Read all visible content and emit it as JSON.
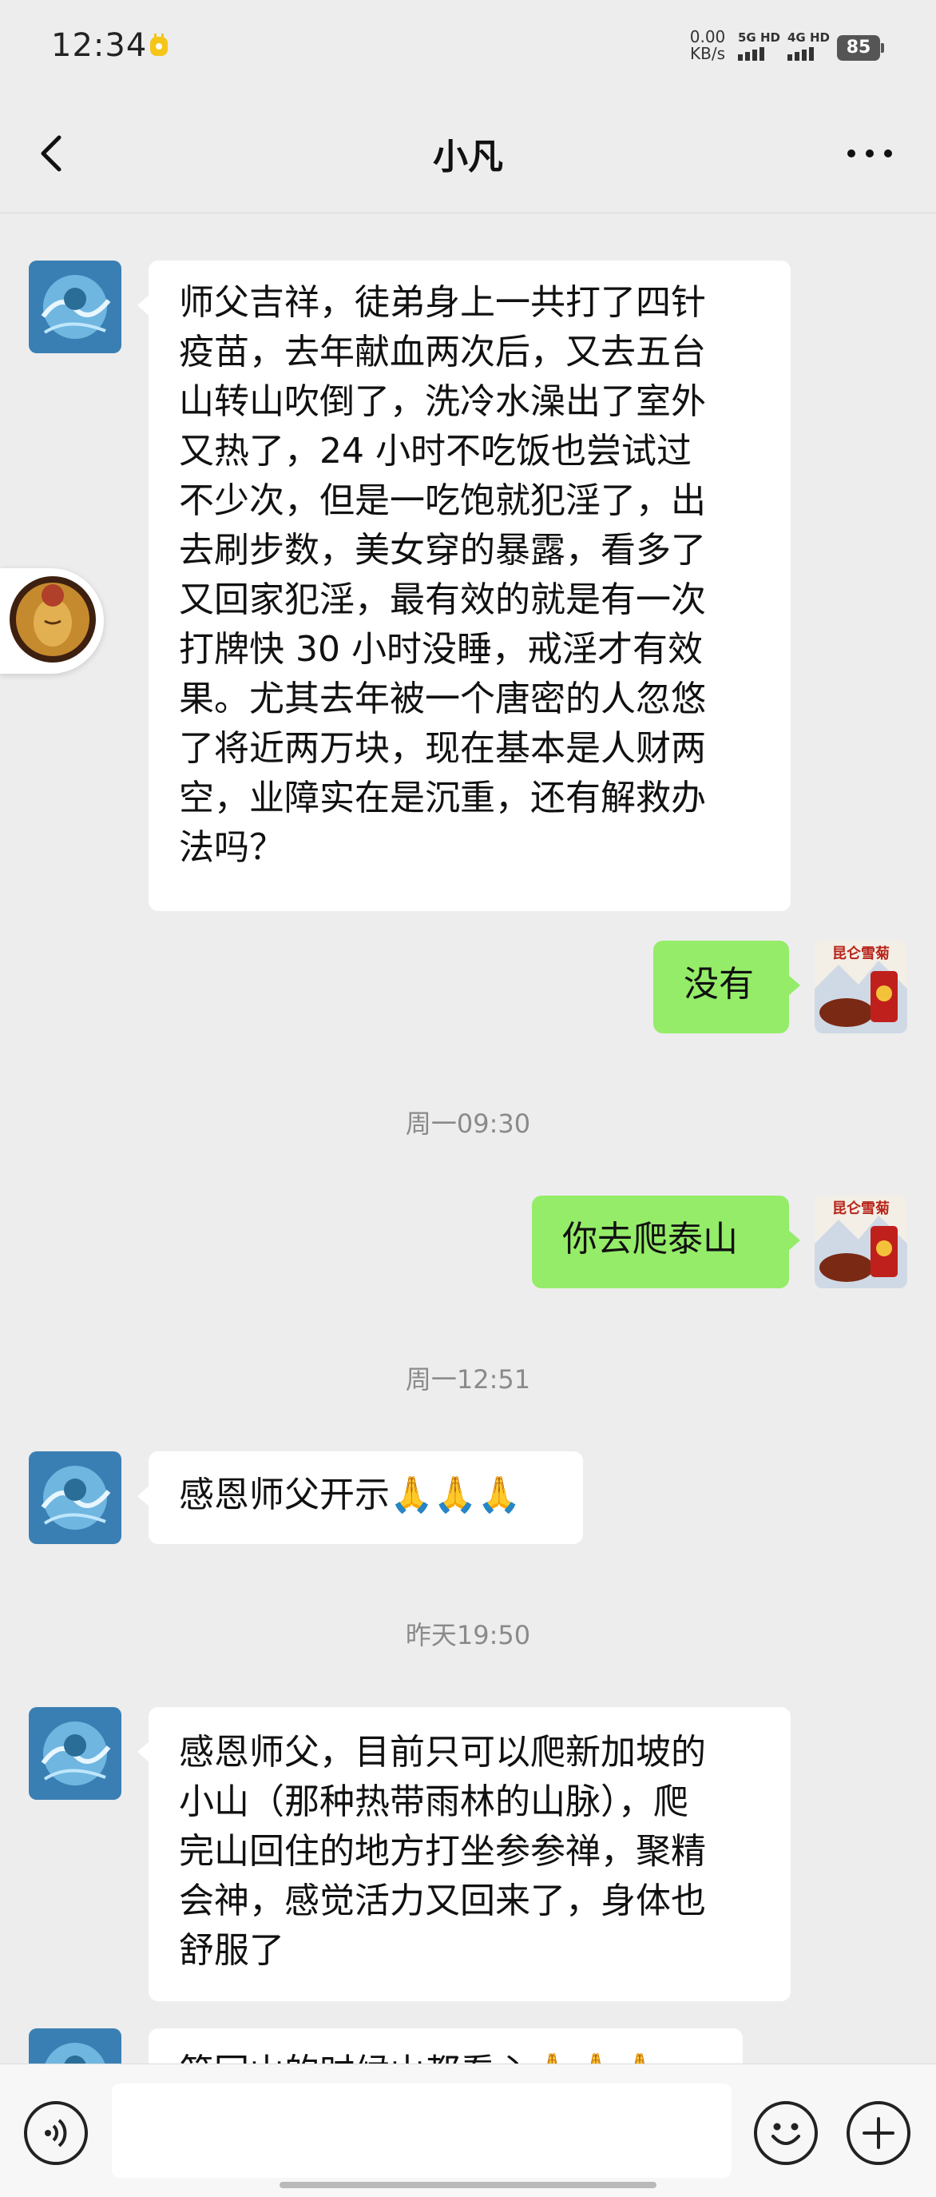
{
  "status_bar": {
    "time": "12:34",
    "net_speed_value": "0.00",
    "net_speed_unit": "KB/s",
    "signal_1": "5G HD",
    "signal_2": "4G HD",
    "battery": "85"
  },
  "header": {
    "title": "小凡",
    "back_icon": "chevron-left-icon",
    "more_icon": "more-dots-icon"
  },
  "messages": [
    {
      "type": "text",
      "direction": "in",
      "text": "师父吉祥，徒弟身上一共打了四针\n疫苗，去年献血两次后，又去五台\n山转山吹倒了，洗冷水澡出了室外\n又热了，24 小时不吃饭也尝试过\n不少次，但是一吃饱就犯淫了，出\n去刷步数，美女穿的暴露，看多了\n又回家犯淫，最有效的就是有一次\n打牌快 30 小时没睡，戒淫才有效\n果。尤其去年被一个唐密的人忽悠\n了将近两万块，现在基本是人财两\n空，业障实在是沉重，还有解救办\n法吗？"
    },
    {
      "type": "text",
      "direction": "out",
      "text": "没有"
    },
    {
      "type": "time",
      "text": "周一09:30"
    },
    {
      "type": "text",
      "direction": "out",
      "text": "你去爬泰山"
    },
    {
      "type": "time",
      "text": "周一12:51"
    },
    {
      "type": "text",
      "direction": "in",
      "text": "感恩师父开示🙏🙏🙏"
    },
    {
      "type": "time",
      "text": "昨天19:50"
    },
    {
      "type": "text",
      "direction": "in",
      "text": "感恩师父，目前只可以爬新加坡的\n小山（那种热带雨林的山脉），爬\n完山回住的地方打坐参参禅，聚精\n会神，感觉活力又回来了，身体也\n舒服了"
    },
    {
      "type": "text",
      "direction": "in",
      "text": "简回山的时候山都看心🙏🙏🙏"
    }
  ],
  "self_avatar_text": "昆仑雪菊",
  "input_bar": {
    "placeholder": "",
    "voice_icon": "voice-icon",
    "emoji_icon": "emoji-icon",
    "plus_icon": "plus-icon"
  },
  "colors": {
    "background": "#ededed",
    "bubble_out": "#95ec69",
    "bubble_in": "#ffffff",
    "timestamp": "#8a8a8a"
  }
}
